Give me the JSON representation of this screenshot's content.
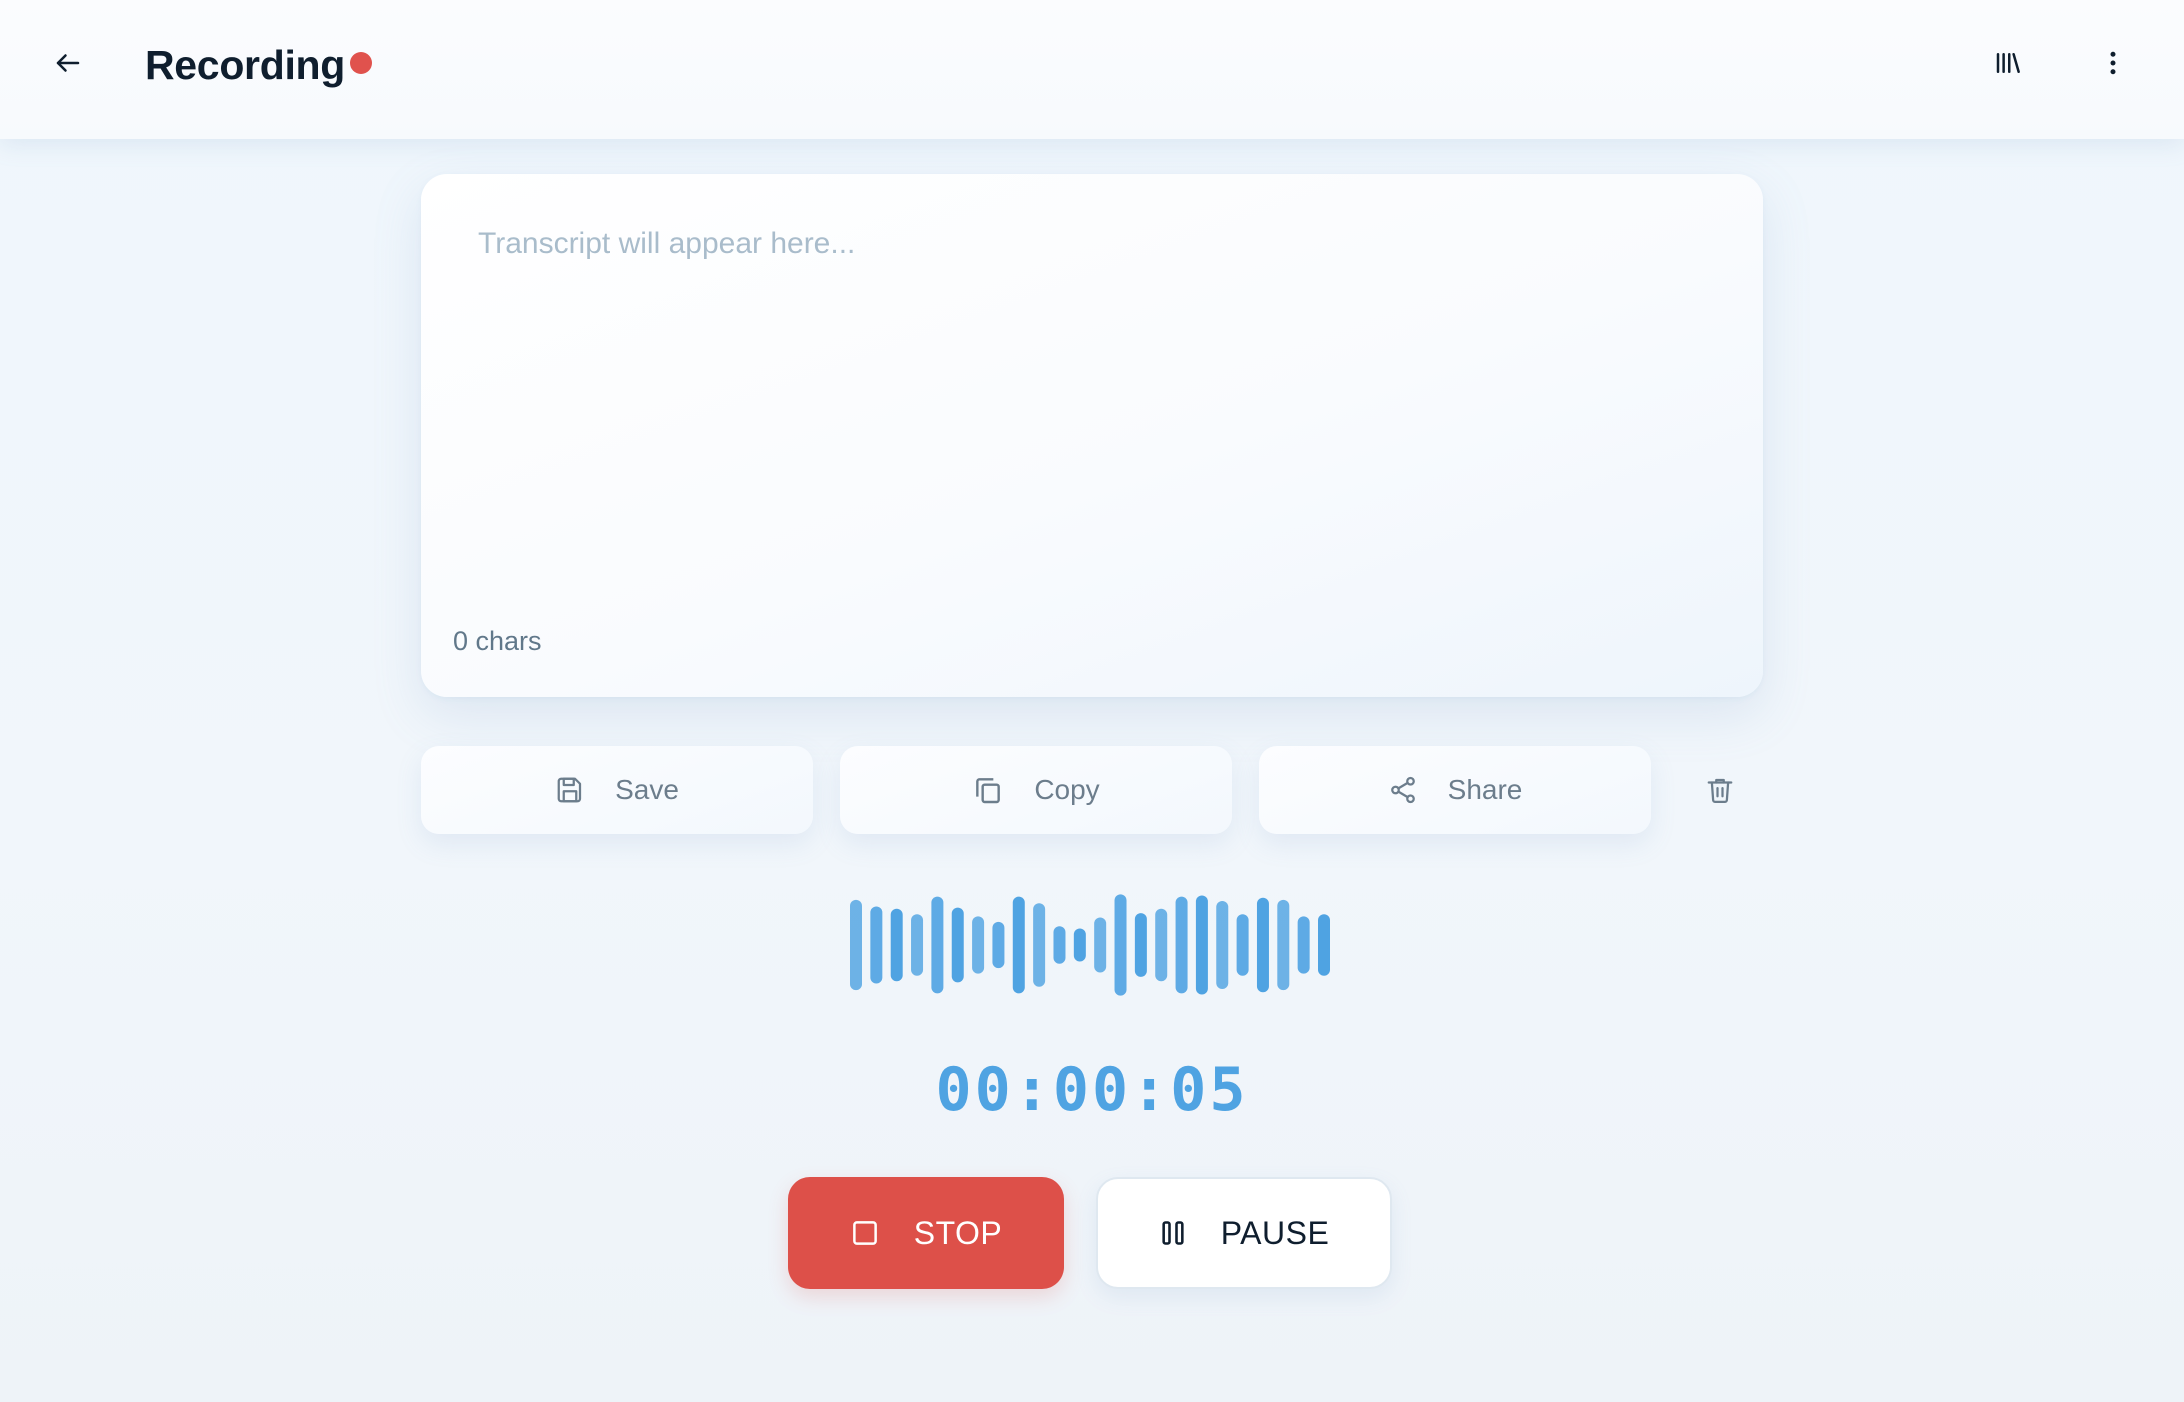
{
  "header": {
    "title": "Recording",
    "back_icon": "arrow-left-icon",
    "library_icon": "library-icon",
    "more_icon": "more-vertical-icon",
    "recording_indicator_color": "#e0524d"
  },
  "transcript": {
    "value": "",
    "placeholder": "Transcript will appear here...",
    "char_count": "0 chars"
  },
  "actions": {
    "save_label": "Save",
    "copy_label": "Copy",
    "share_label": "Share",
    "delete_icon": "trash-icon"
  },
  "waveform": {
    "color": "#4fa3e2",
    "levels": [
      0.82,
      0.7,
      0.66,
      0.56,
      0.88,
      0.68,
      0.52,
      0.42,
      0.88,
      0.76,
      0.34,
      0.3,
      0.5,
      0.92,
      0.58,
      0.66,
      0.88,
      0.9,
      0.8,
      0.56,
      0.86,
      0.82,
      0.52,
      0.56
    ]
  },
  "timer": {
    "elapsed": "00:00:05"
  },
  "controls": {
    "stop_label": "STOP",
    "pause_label": "PAUSE",
    "stop_color": "#dd5049"
  }
}
